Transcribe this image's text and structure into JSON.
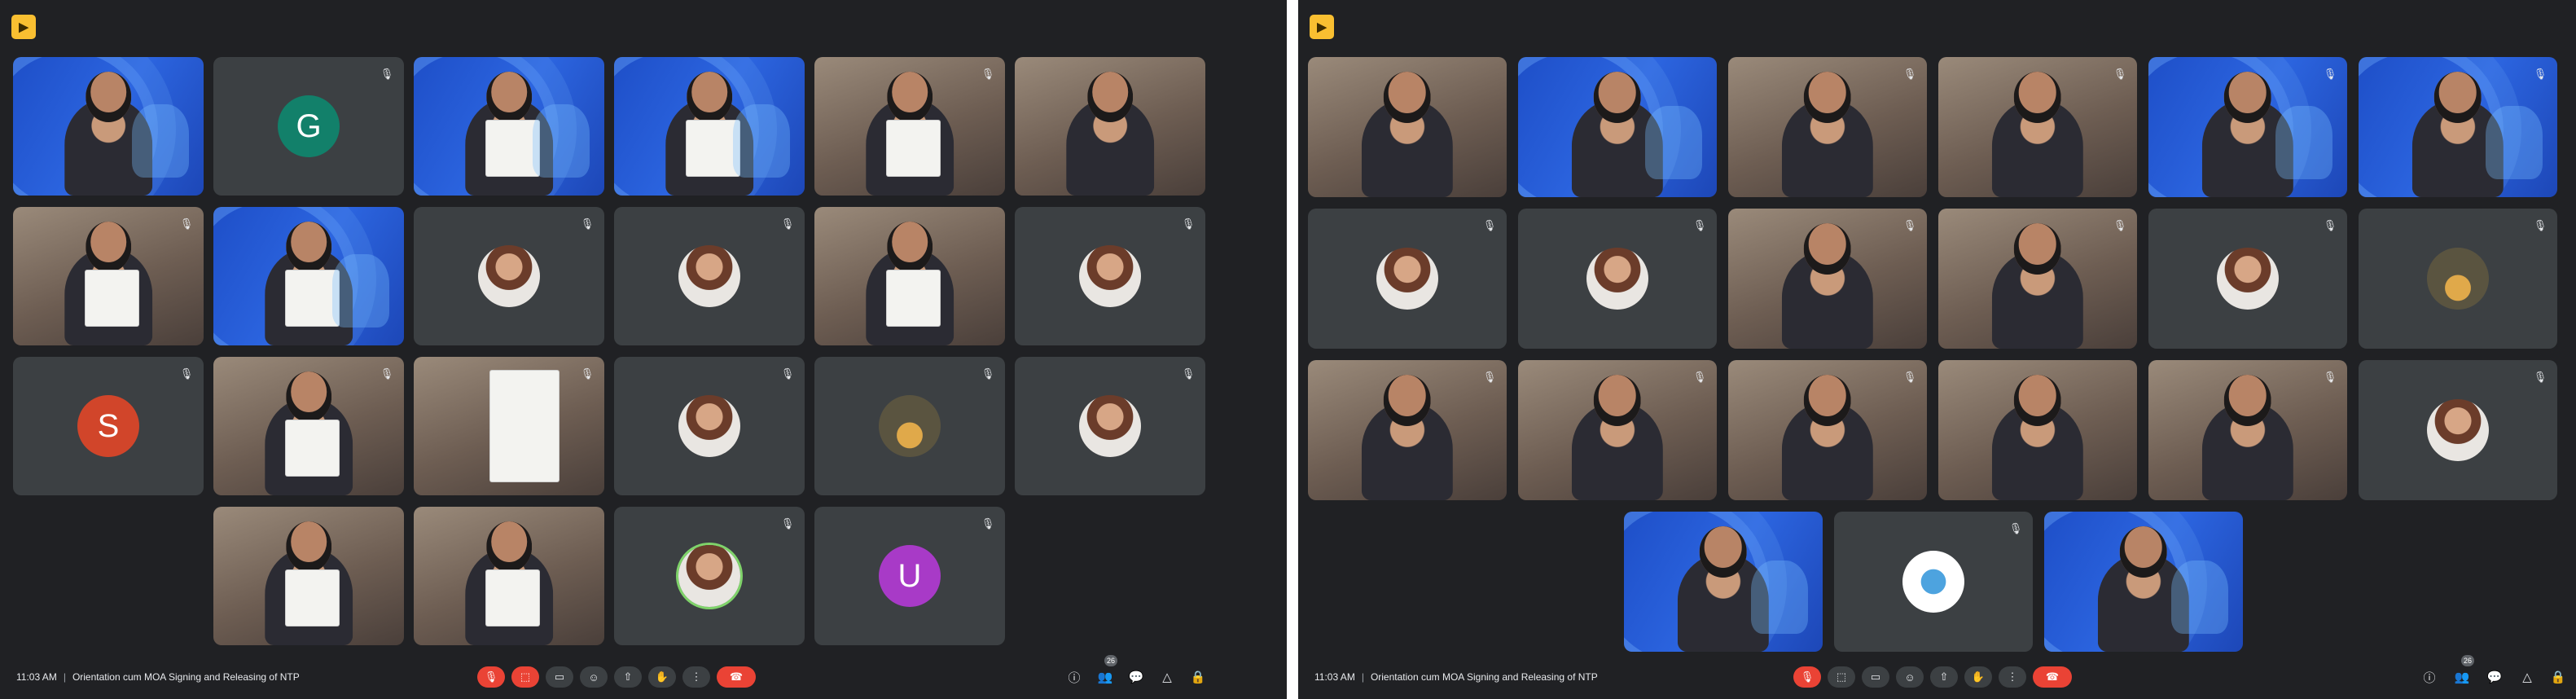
{
  "left_meeting": {
    "time": "11:03 AM",
    "meeting_title": "Orientation cum MOA Signing and Releasing of NTP",
    "participant_count": "26",
    "avatar_letters": [
      "G",
      "S",
      "U"
    ],
    "colors": {
      "avatar_g": "#12806a",
      "avatar_s": "#d1452a",
      "avatar_u": "#a83ac7",
      "background": "#202124",
      "tile": "#3c4043",
      "end_call": "#ea4335"
    }
  },
  "right_meeting": {
    "time": "11:03 AM",
    "meeting_title": "Orientation cum MOA Signing and Releasing of NTP",
    "participant_count": "26"
  },
  "icons": {
    "mic_off": "mic-off-icon",
    "camera_off": "camera-off-icon",
    "captions": "captions-icon",
    "emoji": "emoji-icon",
    "present": "present-icon",
    "raise_hand": "raise-hand-icon",
    "more": "more-options-icon",
    "end_call": "end-call-icon",
    "info": "info-icon",
    "people": "people-icon",
    "chat": "chat-icon",
    "activities": "activities-icon",
    "host_controls": "host-controls-icon"
  }
}
